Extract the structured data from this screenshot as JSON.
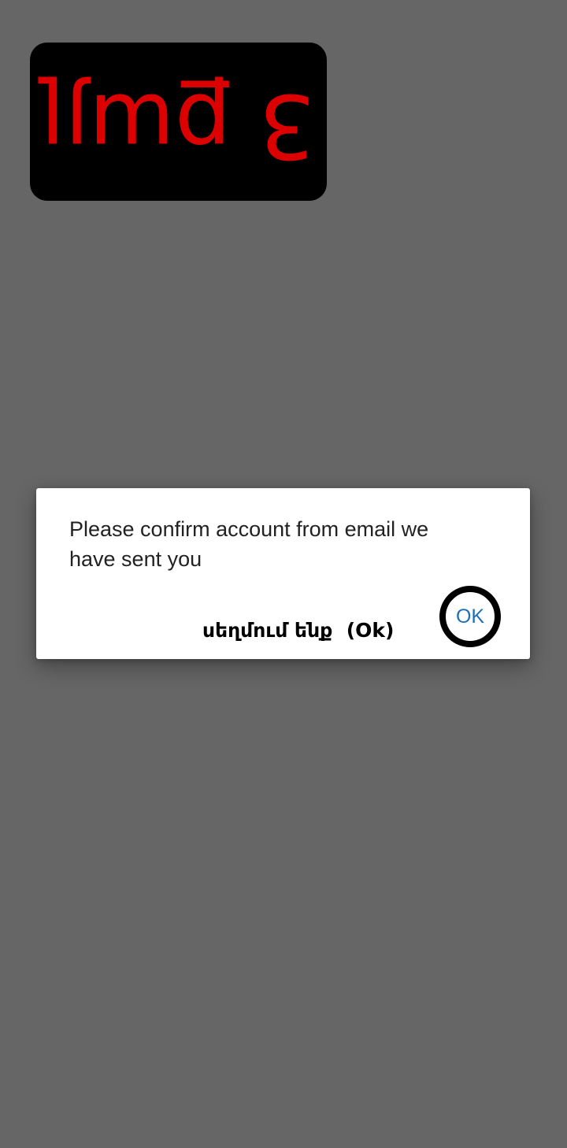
{
  "background": {
    "color": "#666666"
  },
  "step_badge": {
    "text": "3 քայլ",
    "text_color": "#dd0000",
    "background_color": "#000000"
  },
  "dialog": {
    "message": "Please confirm account from email we have sent you",
    "button_label": "սեղմում ենք  (Ok)",
    "ok_button": {
      "label": "OK",
      "text_color": "#1f6fb8",
      "ring_color": "#000000"
    }
  }
}
